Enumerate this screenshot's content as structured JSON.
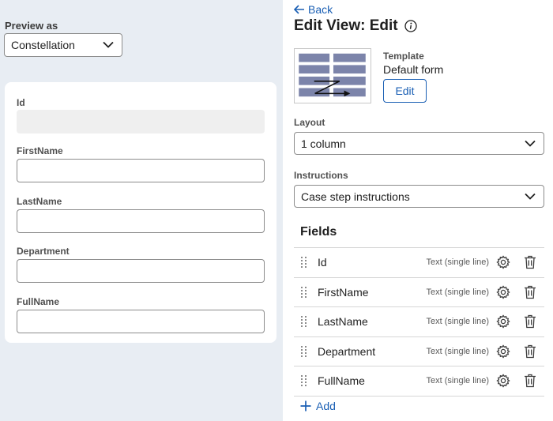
{
  "preview": {
    "label": "Preview as",
    "selected": "Constellation"
  },
  "form": {
    "fields": [
      {
        "label": "Id",
        "readonly": true
      },
      {
        "label": "FirstName",
        "readonly": false
      },
      {
        "label": "LastName",
        "readonly": false
      },
      {
        "label": "Department",
        "readonly": false
      },
      {
        "label": "FullName",
        "readonly": false
      }
    ]
  },
  "editor": {
    "back_label": "Back",
    "title": "Edit View: Edit",
    "template": {
      "label": "Template",
      "value": "Default form",
      "edit_label": "Edit"
    },
    "layout": {
      "label": "Layout",
      "selected": "1 column"
    },
    "instructions": {
      "label": "Instructions",
      "selected": "Case step instructions"
    },
    "fields_title": "Fields",
    "fields": [
      {
        "name": "Id",
        "type": "Text (single line)"
      },
      {
        "name": "FirstName",
        "type": "Text (single line)"
      },
      {
        "name": "LastName",
        "type": "Text (single line)"
      },
      {
        "name": "Department",
        "type": "Text (single line)"
      },
      {
        "name": "FullName",
        "type": "Text (single line)"
      }
    ],
    "add_label": "Add"
  },
  "colors": {
    "accent": "#1a5fb4",
    "preview_bg": "#e8edf3"
  },
  "icons": {
    "back": "arrow-left-icon",
    "info": "info-icon",
    "dropdown": "chevron-down-icon",
    "drag": "drag-handle-icon",
    "settings": "gear-icon",
    "delete": "trash-icon",
    "add": "plus-icon"
  }
}
